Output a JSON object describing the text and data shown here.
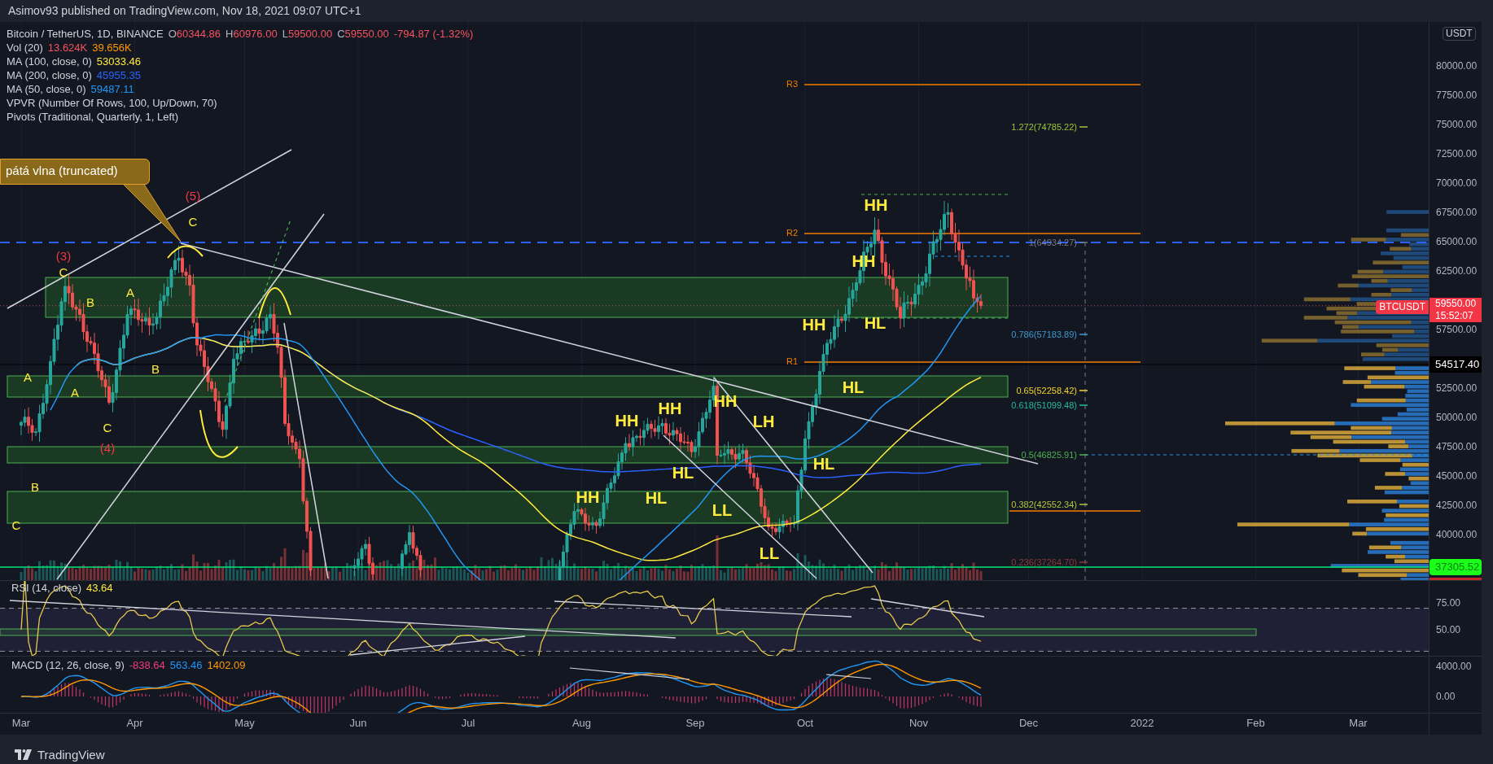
{
  "header": {
    "text": "Asimov93 published on TradingView.com, Nov 18, 2021 09:07 UTC+1"
  },
  "legend": {
    "symbol": "Bitcoin / TetherUS, 1D, BINANCE",
    "ohlc": [
      {
        "key": "O",
        "value": "60344.86"
      },
      {
        "key": "H",
        "value": "60976.00"
      },
      {
        "key": "L",
        "value": "59500.00"
      },
      {
        "key": "C",
        "value": "59550.00"
      }
    ],
    "change": "-794.87 (-1.32%)",
    "indicators": [
      {
        "name": "Vol (20)",
        "values": [
          {
            "text": "13.624K",
            "color": "#f7525f"
          },
          {
            "text": "39.656K",
            "color": "#ff9800"
          }
        ]
      },
      {
        "name": "MA (100, close, 0)",
        "values": [
          {
            "text": "53033.46",
            "color": "#ffeb3b"
          }
        ]
      },
      {
        "name": "MA (200, close, 0)",
        "values": [
          {
            "text": "45955.35",
            "color": "#2962ff"
          }
        ]
      },
      {
        "name": "MA (50, close, 0)",
        "values": [
          {
            "text": "59487.11",
            "color": "#2196f3"
          }
        ]
      },
      {
        "name": "VPVR (Number Of Rows, 100, Up/Down, 70)"
      },
      {
        "name": "Pivots (Traditional, Quarterly, 1, Left)"
      }
    ]
  },
  "price_chart": {
    "currency": "USDT",
    "price_axis": [
      "80000.00",
      "77500.00",
      "75000.00",
      "72500.00",
      "70000.00",
      "67500.00",
      "65000.00",
      "62500.00",
      "57500.00",
      "52500.00",
      "50000.00",
      "47500.00",
      "45000.00",
      "42500.00",
      "40000.00"
    ],
    "time_axis": [
      "Mar",
      "Apr",
      "May",
      "Jun",
      "Jul",
      "Aug",
      "Sep",
      "Oct",
      "Nov",
      "Dec",
      "2022",
      "Feb",
      "Mar"
    ],
    "price_labels": [
      {
        "kind": "symbol",
        "text": "BTCUSDT"
      },
      {
        "kind": "last",
        "text": "59550.00",
        "sub": "15:52:07"
      },
      {
        "kind": "crosshair",
        "text": "54517.40"
      },
      {
        "kind": "level",
        "text": "37305.52"
      }
    ],
    "callout": {
      "text": "pátá vlna (truncated)"
    },
    "annotations": [
      {
        "kind": "count",
        "text": "(5)"
      },
      {
        "kind": "structure",
        "text": "HH"
      },
      {
        "kind": "wave",
        "text": "C"
      },
      {
        "kind": "count",
        "text": "(3)"
      },
      {
        "kind": "structure",
        "text": "HH"
      },
      {
        "kind": "wave",
        "text": "C"
      },
      {
        "kind": "wave",
        "text": "B"
      },
      {
        "kind": "wave",
        "text": "A"
      },
      {
        "kind": "structure",
        "text": "HH"
      },
      {
        "kind": "structure",
        "text": "HL"
      },
      {
        "kind": "wave",
        "text": "A"
      },
      {
        "kind": "wave",
        "text": "B"
      },
      {
        "kind": "wave",
        "text": "A"
      },
      {
        "kind": "structure",
        "text": "HL"
      },
      {
        "kind": "structure",
        "text": "HH"
      },
      {
        "kind": "structure",
        "text": "HH"
      },
      {
        "kind": "wave",
        "text": "C"
      },
      {
        "kind": "structure",
        "text": "HH"
      },
      {
        "kind": "structure",
        "text": "LH"
      },
      {
        "kind": "count",
        "text": "(4)"
      },
      {
        "kind": "structure",
        "text": "HL"
      },
      {
        "kind": "structure",
        "text": "HL"
      },
      {
        "kind": "wave",
        "text": "B"
      },
      {
        "kind": "structure",
        "text": "HH"
      },
      {
        "kind": "structure",
        "text": "HL"
      },
      {
        "kind": "structure",
        "text": "LL"
      },
      {
        "kind": "wave",
        "text": "C"
      },
      {
        "kind": "structure",
        "text": "LL"
      }
    ],
    "pivots": [
      {
        "text": "R3"
      },
      {
        "text": "R2"
      },
      {
        "text": "R1"
      }
    ],
    "fib_levels": [
      {
        "text": "1.272(74785.22)",
        "color": "#9fc43a"
      },
      {
        "text": "1(64934.27)",
        "color": "#787b86"
      },
      {
        "text": "0.786(57183.89)",
        "color": "#3d9ad1"
      },
      {
        "text": "0.65(52258.42)",
        "color": "#f0d430"
      },
      {
        "text": "0.618(51099.48)",
        "color": "#26b8a0"
      },
      {
        "text": "0.5(46825.91)",
        "color": "#4caf50"
      },
      {
        "text": "0.382(42552.34)",
        "color": "#b5c43a"
      },
      {
        "text": "0.236(37264.70)",
        "color": "#8c3a3a"
      }
    ]
  },
  "rsi": {
    "name": "RSI (14, close)",
    "value": "43.64",
    "yticks": [
      "75.00",
      "50.00"
    ]
  },
  "macd": {
    "name": "MACD (12, 26, close, 9)",
    "values": [
      {
        "text": "-838.64",
        "color": "#f23c7a"
      },
      {
        "text": "563.46",
        "color": "#2196f3"
      },
      {
        "text": "1402.09",
        "color": "#ff9800"
      }
    ],
    "yticks": [
      "4000.00",
      "0.00"
    ]
  },
  "footer": {
    "brand": "TradingView"
  }
}
